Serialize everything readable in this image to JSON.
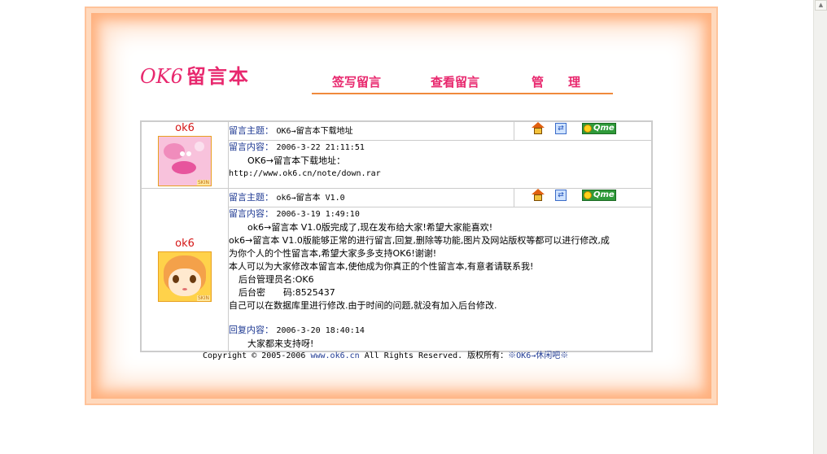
{
  "site": {
    "logo_ok": "OK6",
    "logo_cn": "留言本",
    "nav": [
      "签写留言",
      "查看留言",
      "管　　理"
    ]
  },
  "messages": [
    {
      "author": "ok6",
      "subject_label": "留言主题：",
      "subject": "OK6→留言本下载地址",
      "content_label": "留言内容：",
      "date": "2006-3-22 21:11:51",
      "lines": [
        "OK6→留言本下载地址：",
        "http://www.ok6.cn/note/down.rar"
      ],
      "reply": null
    },
    {
      "author": "ok6",
      "subject_label": "留言主题：",
      "subject": "ok6→留言本 V1.0",
      "content_label": "留言内容：",
      "date": "2006-3-19 1:49:10",
      "lines": [
        "ok6→留言本 V1.0版完成了,现在发布给大家!希望大家能喜欢!",
        "ok6→留言本 V1.0版能够正常的进行留言,回复,删除等功能,图片及网站版权等都可以进行修改,成",
        "为你个人的个性留言本,希望大家多多支持OK6!谢谢!",
        "本人可以为大家修改本留言本,使他成为你真正的个性留言本,有意者请联系我!",
        "后台管理员名:OK6",
        "后台密　　码:8525437",
        "自己可以在数据库里进行修改.由于时间的问题,就没有加入后台修改."
      ],
      "reply": {
        "label": "回复内容：",
        "date": "2006-3-20 18:40:14",
        "text": "大家都来支持呀!"
      }
    }
  ],
  "footer": {
    "prefix": "Copyright © 2005-2006",
    "link": "www.ok6.cn",
    "middle": "All Rights Reserved. 版权所有：",
    "owner": "※OK6→休闲吧※"
  },
  "icons": [
    "home-icon",
    "swap-icon",
    "qme-icon"
  ],
  "colors": {
    "accent": "#e8286e",
    "label": "#1f3a93",
    "frame": "#ffb07d"
  }
}
